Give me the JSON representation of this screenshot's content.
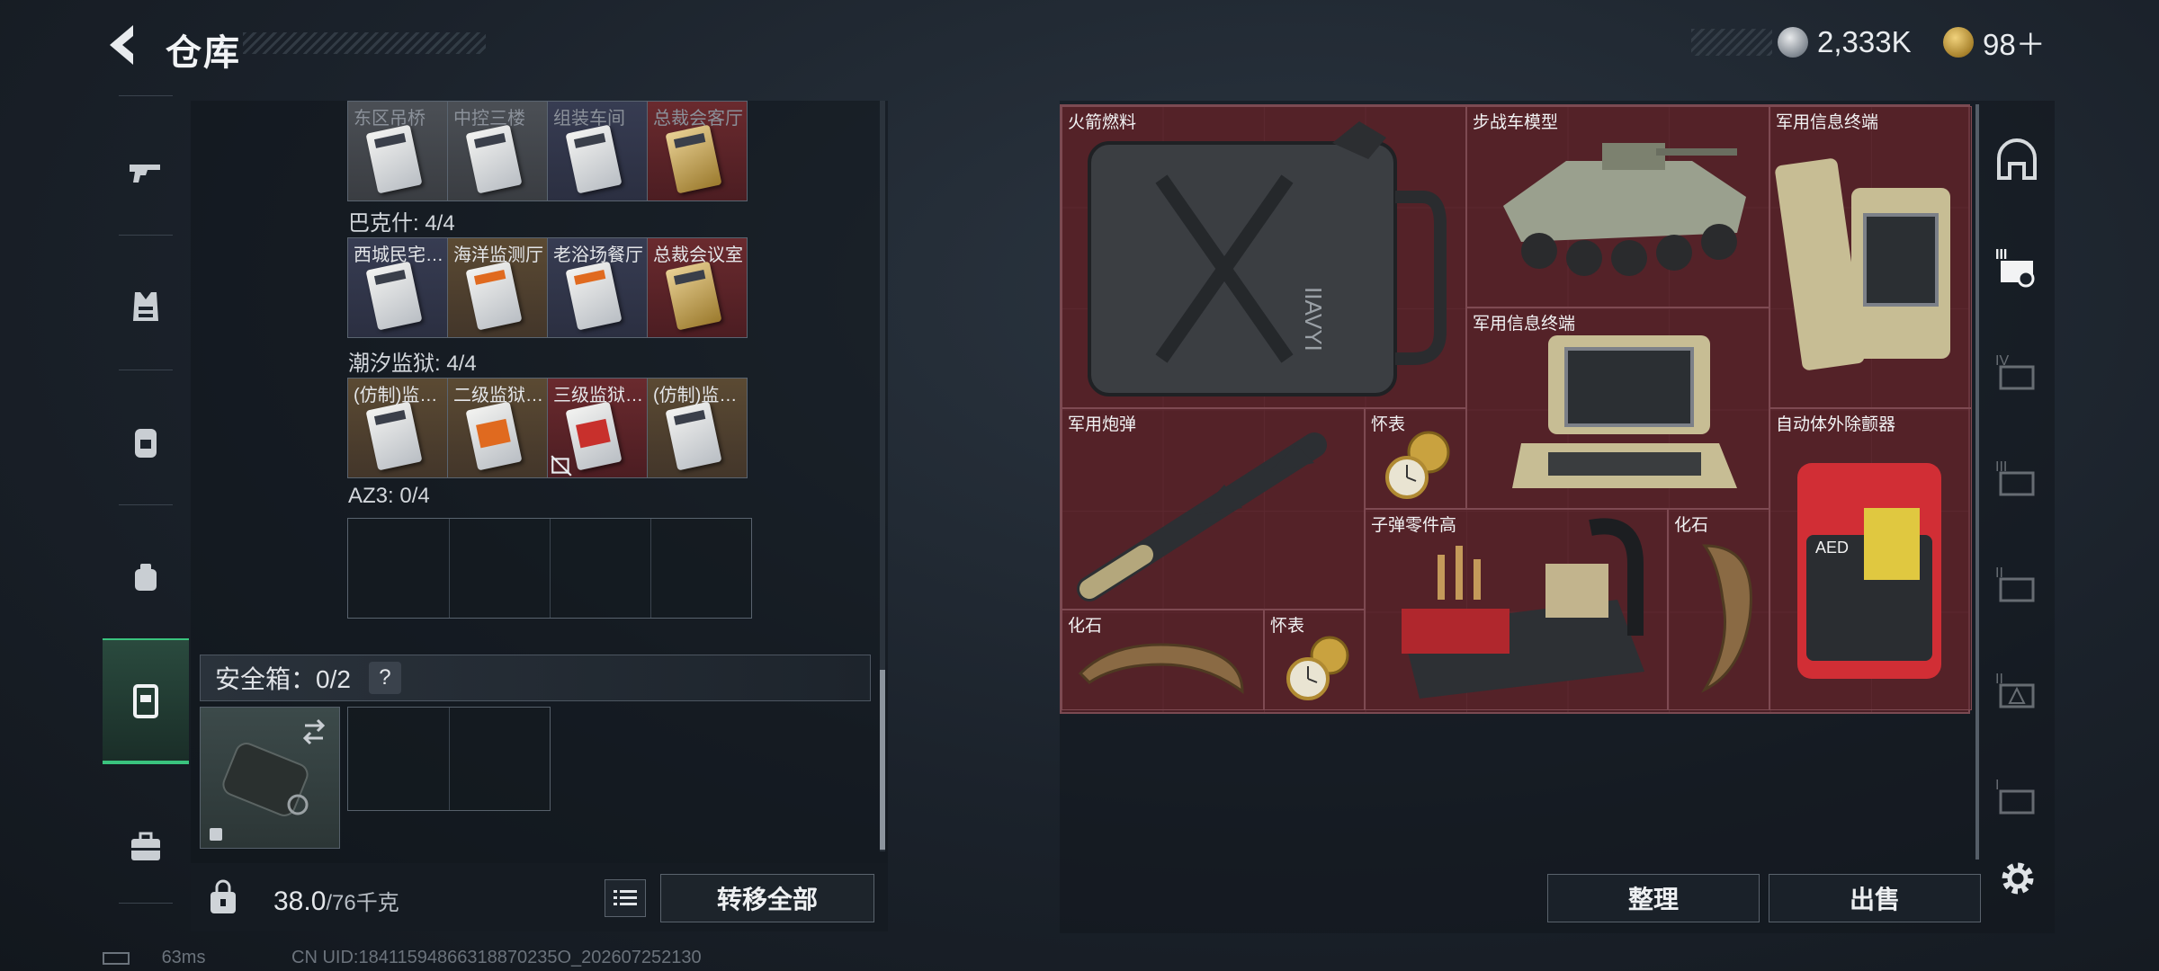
{
  "header": {
    "title": "仓库",
    "currency_silver": "2,333K",
    "currency_gold": "98＋"
  },
  "left_rail": {
    "items": [
      {
        "icon": "gun-icon"
      },
      {
        "icon": "vest-icon"
      },
      {
        "icon": "backpack-icon"
      },
      {
        "icon": "pouch-icon"
      },
      {
        "icon": "safe-box-icon",
        "active": true
      },
      {
        "icon": "briefcase-icon"
      }
    ]
  },
  "keycards": {
    "row1": [
      {
        "label": "东区吊桥",
        "color": "gray"
      },
      {
        "label": "中控三楼",
        "color": "gray"
      },
      {
        "label": "组装车间",
        "color": "navy"
      },
      {
        "label": "总裁会客厅",
        "color": "red"
      }
    ],
    "group2_title": "巴克什: 4/4",
    "row2": [
      {
        "label": "西城民宅…",
        "color": "navy"
      },
      {
        "label": "海洋监测厅",
        "color": "brown"
      },
      {
        "label": "老浴场餐厅",
        "color": "navy"
      },
      {
        "label": "总裁会议室",
        "color": "red"
      }
    ],
    "group3_title": "潮汐监狱: 4/4",
    "row3": [
      {
        "label": "(仿制)监…",
        "color": "brown"
      },
      {
        "label": "二级监狱…",
        "color": "brown"
      },
      {
        "label": "三级监狱…",
        "color": "red"
      },
      {
        "label": "(仿制)监…",
        "color": "brown"
      }
    ],
    "group4_title": "AZ3: 0/4"
  },
  "safe_box": {
    "label": "安全箱：0/2",
    "help": "?"
  },
  "footer": {
    "weight_value": "38.0",
    "weight_max": "/76千克",
    "transfer_all": "转移全部"
  },
  "status": {
    "ping": "63ms",
    "uid": "CN UID:18411594866318870235O_202607252130"
  },
  "stash_items": [
    {
      "name": "火箭燃料"
    },
    {
      "name": "步战车模型"
    },
    {
      "name": "军用信息终端"
    },
    {
      "name": "军用信息终端"
    },
    {
      "name": "军用炮弹"
    },
    {
      "name": "怀表"
    },
    {
      "name": "自动体外除颤器"
    },
    {
      "name": "子弹零件高"
    },
    {
      "name": "化石"
    },
    {
      "name": "化石"
    },
    {
      "name": "怀表"
    }
  ],
  "right_tabs": [
    {
      "icon": "dome-icon"
    },
    {
      "icon": "tier-3-container-icon"
    },
    {
      "icon": "tier-4-container-icon"
    },
    {
      "icon": "tier-3-container-icon"
    },
    {
      "icon": "tier-2-container-icon"
    },
    {
      "icon": "tier-2-warning-container-icon"
    },
    {
      "icon": "tier-1-container-icon"
    }
  ],
  "actions": {
    "sort": "整理",
    "sell": "出售"
  },
  "colors": {
    "accent_green": "#3ac37e",
    "stash_red": "#4a1f25"
  }
}
